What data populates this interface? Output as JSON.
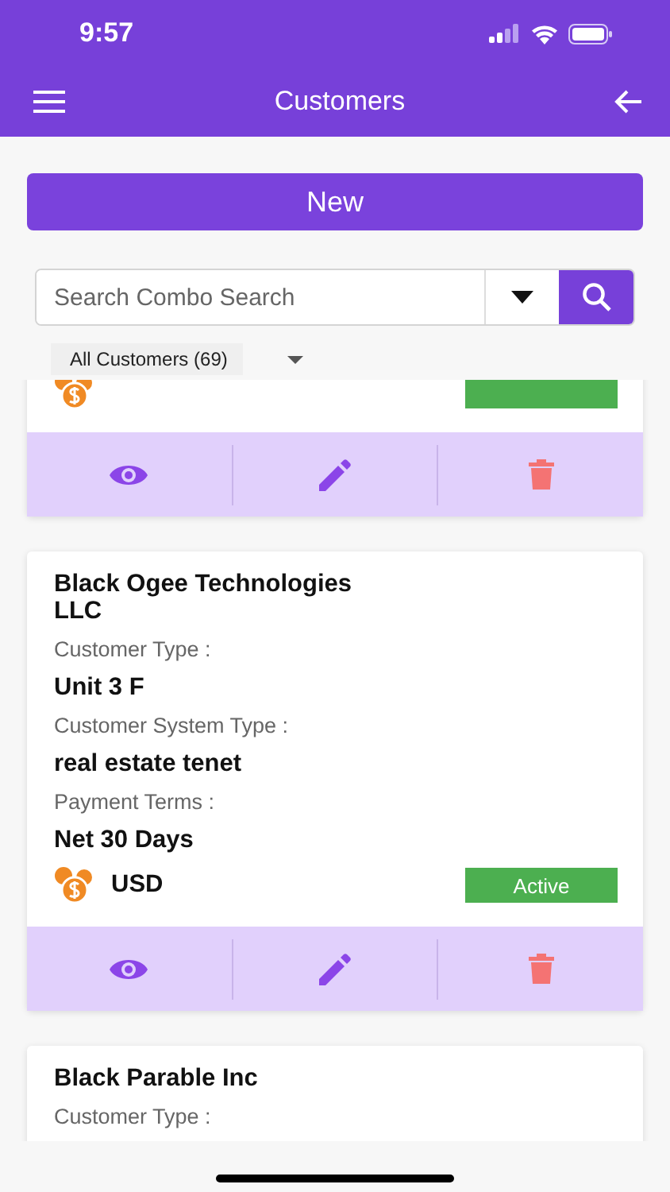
{
  "status_bar": {
    "time": "9:57"
  },
  "header": {
    "title": "Customers"
  },
  "new_button": {
    "label": "New"
  },
  "search": {
    "placeholder": "Search Combo Search"
  },
  "filter": {
    "label": "All Customers (69)"
  },
  "customers": [
    {
      "kind": "partial",
      "actions": [
        {
          "kind": "view"
        },
        {
          "kind": "edit"
        },
        {
          "kind": "delete"
        }
      ]
    },
    {
      "kind": "full",
      "name": "Black Ogee Technologies LLC",
      "fields": [
        {
          "label": "Customer Type :",
          "value": "Unit 3 F"
        },
        {
          "label": "Customer System Type :",
          "value": "real estate tenet"
        },
        {
          "label": "Payment Terms :",
          "value": "Net 30 Days"
        }
      ],
      "footer": {
        "currency": "USD",
        "status": "Active"
      },
      "actions": [
        {
          "kind": "view"
        },
        {
          "kind": "edit"
        },
        {
          "kind": "delete"
        }
      ]
    },
    {
      "kind": "full",
      "name": "Black Parable Inc",
      "fields": [
        {
          "label": "Customer Type :"
        }
      ]
    }
  ]
}
